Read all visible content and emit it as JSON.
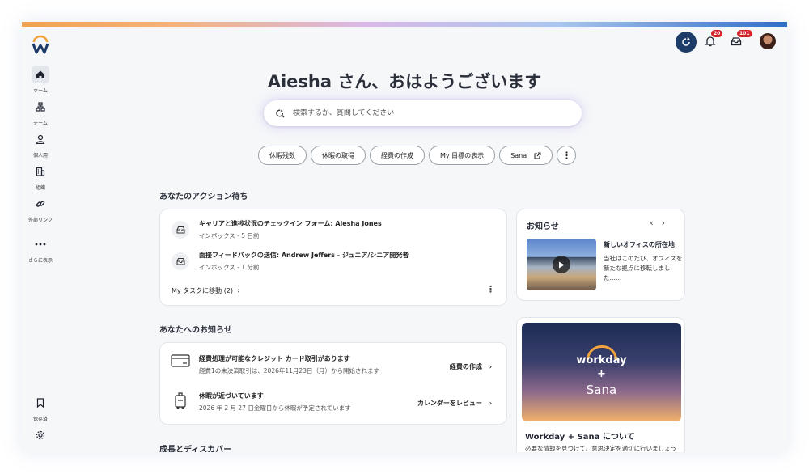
{
  "header": {
    "notifications_count": "20",
    "inbox_count": "101"
  },
  "sidebar": {
    "items": [
      {
        "label": "ホーム"
      },
      {
        "label": "チーム"
      },
      {
        "label": "個人用"
      },
      {
        "label": "組織"
      },
      {
        "label": "外部リンク"
      },
      {
        "label": "さらに表示"
      },
      {
        "label": "保存済"
      }
    ]
  },
  "greeting": "Aiesha さん、おはようございます",
  "search": {
    "placeholder": "検索するか、質問してください"
  },
  "chips": [
    {
      "label": "休暇残数"
    },
    {
      "label": "休暇の取得"
    },
    {
      "label": "経費の作成"
    },
    {
      "label": "My 目標の表示"
    },
    {
      "label": "Sana"
    }
  ],
  "actions": {
    "title": "あなたのアクション待ち",
    "items": [
      {
        "title": "キャリアと進捗状況のチェックイン フォーム: Aiesha Jones",
        "sub": "インボックス - 5 日前"
      },
      {
        "title": "面接フィードバックの送信: Andrew Jeffers - ジュニア/シニア開発者",
        "sub": "インボックス - 1 分前"
      }
    ],
    "link": "My タスクに移動 (2)"
  },
  "news": {
    "title": "お知らせ",
    "headline": "新しいオフィスの所在地",
    "body": "当社はこのたび、オフィスを新たな拠点に移転しました……"
  },
  "notices": {
    "title": "あなたへのお知らせ",
    "items": [
      {
        "title": "経費処理が可能なクレジット カード取引があります",
        "sub": "経費1の未決済取引は、2026年11月23日（月）から開始されます",
        "action": "経費の作成"
      },
      {
        "title": "休暇が近づいています",
        "sub": "2026 年 2 月 27 日金曜日から休暇が予定されています",
        "action": "カレンダーをレビュー"
      }
    ]
  },
  "growth": {
    "title": "成長とディスカバー"
  },
  "promo": {
    "logo_workday": "workday",
    "logo_plus": "+",
    "logo_sana": "Sana",
    "title": "Workday + Sana について",
    "sub": "必要な情報を見つけて、意思決定を適切に行いましょう"
  },
  "colors": {
    "accent": "#1c3b67",
    "badge": "#d6262b",
    "brand_orange": "#f2a23a"
  }
}
